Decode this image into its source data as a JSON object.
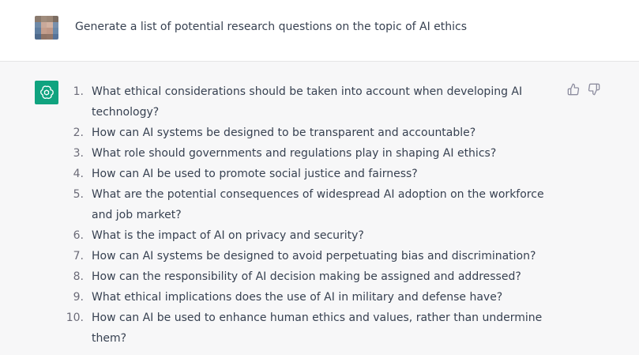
{
  "user": {
    "avatar_icon": "user-avatar-pixelated",
    "message": "Generate a list of potential research questions on the topic of AI ethics"
  },
  "assistant": {
    "avatar_icon": "openai-logo-icon",
    "accent_color": "#10a37f",
    "items": [
      {
        "number": "1.",
        "text": "What ethical considerations should be taken into account when developing AI technology?"
      },
      {
        "number": "2.",
        "text": "How can AI systems be designed to be transparent and accountable?"
      },
      {
        "number": "3.",
        "text": "What role should governments and regulations play in shaping AI ethics?"
      },
      {
        "number": "4.",
        "text": "How can AI be used to promote social justice and fairness?"
      },
      {
        "number": "5.",
        "text": "What are the potential consequences of widespread AI adoption on the workforce and job market?"
      },
      {
        "number": "6.",
        "text": "What is the impact of AI on privacy and security?"
      },
      {
        "number": "7.",
        "text": "How can AI systems be designed to avoid perpetuating bias and discrimination?"
      },
      {
        "number": "8.",
        "text": "How can the responsibility of AI decision making be assigned and addressed?"
      },
      {
        "number": "9.",
        "text": "What ethical implications does the use of AI in military and defense have?"
      },
      {
        "number": "10.",
        "text": "How can AI be used to enhance human ethics and values, rather than undermine them?"
      }
    ],
    "feedback": {
      "thumbs_up_icon": "thumbs-up-icon",
      "thumbs_down_icon": "thumbs-down-icon"
    }
  }
}
